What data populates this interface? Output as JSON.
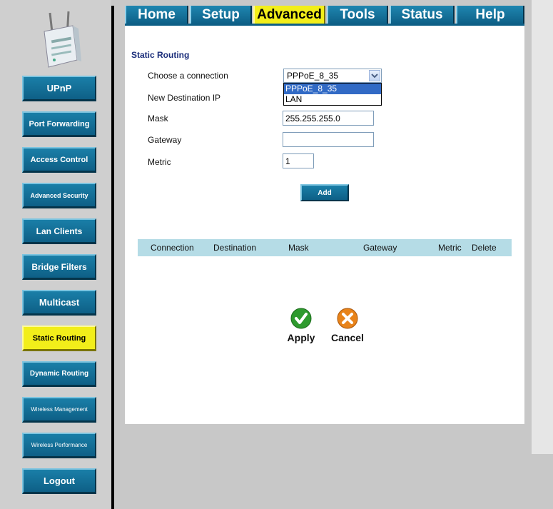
{
  "sidebar": {
    "items": [
      {
        "label": "UPnP"
      },
      {
        "label": "Port Forwarding"
      },
      {
        "label": "Access Control"
      },
      {
        "label": "Advanced Security"
      },
      {
        "label": "Lan Clients"
      },
      {
        "label": "Bridge Filters"
      },
      {
        "label": "Multicast"
      },
      {
        "label": "Static Routing",
        "active": true
      },
      {
        "label": "Dynamic Routing"
      },
      {
        "label": "Wireless Management"
      },
      {
        "label": "Wireless Performance"
      },
      {
        "label": "Logout"
      }
    ]
  },
  "tabs": [
    {
      "label": "Home"
    },
    {
      "label": "Setup"
    },
    {
      "label": "Advanced",
      "active": true
    },
    {
      "label": "Tools"
    },
    {
      "label": "Status"
    },
    {
      "label": "Help"
    }
  ],
  "form": {
    "title": "Static Routing",
    "connection_label": "Choose a connection",
    "connection_value": "PPPoE_8_35",
    "connection_options": [
      "PPPoE_8_35",
      "LAN"
    ],
    "dest_label": "New Destination IP",
    "mask_label": "Mask",
    "mask_value": "255.255.255.0",
    "gateway_label": "Gateway",
    "gateway_value": "",
    "metric_label": "Metric",
    "metric_value": "1",
    "add_label": "Add"
  },
  "table": {
    "headers": [
      "Connection",
      "Destination",
      "Mask",
      "Gateway",
      "Metric",
      "Delete"
    ]
  },
  "actions": {
    "apply_label": "Apply",
    "cancel_label": "Cancel"
  },
  "colors": {
    "accent_blue": "#0e5f86",
    "active_yellow": "#f2ee1a",
    "table_header": "#b5dce6",
    "selected_option": "#316ac5"
  },
  "icons": [
    "router-device-icon",
    "dropdown-arrow-icon",
    "apply-check-icon",
    "cancel-x-icon"
  ]
}
